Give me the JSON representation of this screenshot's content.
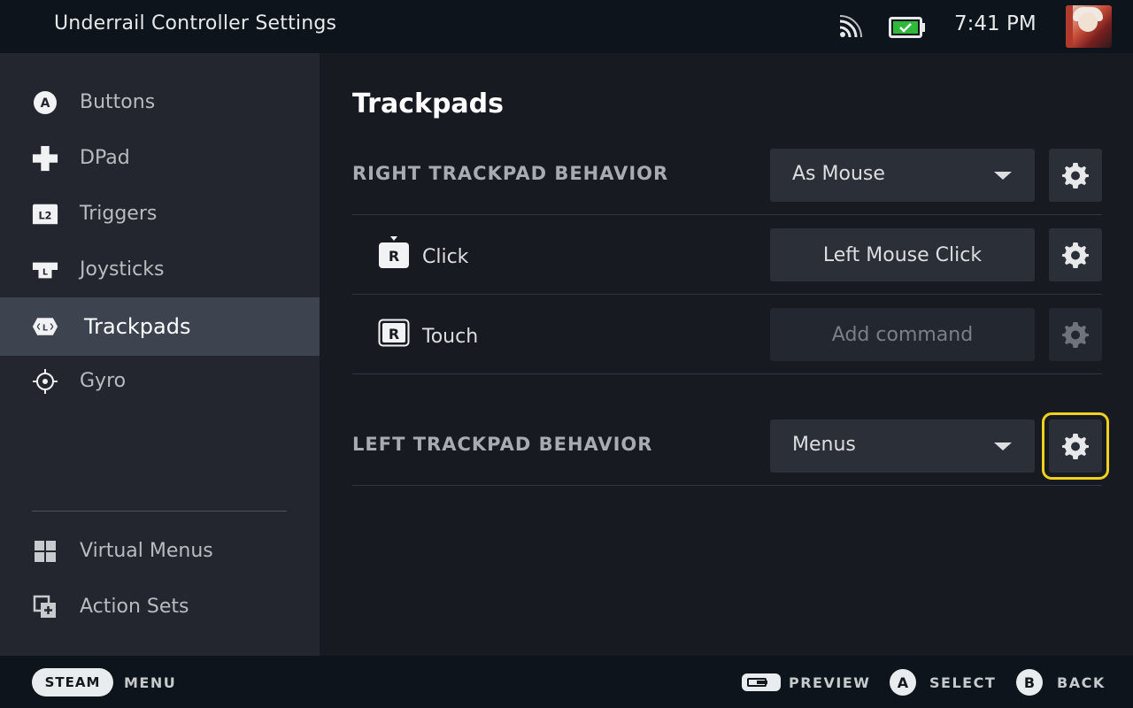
{
  "header": {
    "title": "Underrail Controller Settings",
    "time": "7:41 PM",
    "icons": [
      "wifi-icon",
      "battery-charging-icon",
      "avatar"
    ],
    "battery_color": "#2fb83a"
  },
  "sidebar": {
    "items": [
      {
        "label": "Buttons",
        "icon": "a-button-icon"
      },
      {
        "label": "DPad",
        "icon": "dpad-icon"
      },
      {
        "label": "Triggers",
        "icon": "l2-trigger-icon"
      },
      {
        "label": "Joysticks",
        "icon": "joystick-icon"
      },
      {
        "label": "Trackpads",
        "icon": "trackpad-icon",
        "active": true
      },
      {
        "label": "Gyro",
        "icon": "gyro-icon"
      }
    ],
    "bottom_items": [
      {
        "label": "Virtual Menus",
        "icon": "virtual-menus-icon"
      },
      {
        "label": "Action Sets",
        "icon": "action-sets-icon"
      }
    ]
  },
  "main": {
    "title": "Trackpads",
    "right_trackpad": {
      "label": "RIGHT TRACKPAD BEHAVIOR",
      "behavior": "As Mouse",
      "click": {
        "label": "Click",
        "key": "R",
        "command": "Left Mouse Click"
      },
      "touch": {
        "label": "Touch",
        "key": "R",
        "command": "Add command"
      }
    },
    "left_trackpad": {
      "label": "LEFT TRACKPAD BEHAVIOR",
      "behavior": "Menus"
    }
  },
  "footer": {
    "steam_label": "STEAM",
    "menu_label": "MENU",
    "preview_label": "PREVIEW",
    "select_key": "A",
    "select_label": "SELECT",
    "back_key": "B",
    "back_label": "BACK"
  },
  "colors": {
    "focus_outline": "#f0d21c",
    "active_item_bg": "#3d4450"
  }
}
